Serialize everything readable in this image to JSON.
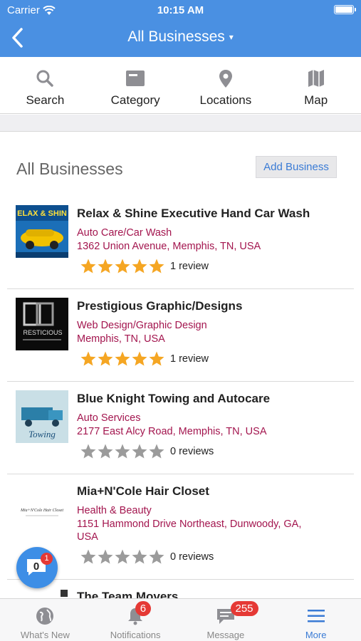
{
  "status_bar": {
    "carrier": "Carrier",
    "time": "10:15 AM"
  },
  "nav": {
    "title": "All Businesses",
    "caret": "▾"
  },
  "toolbar": [
    {
      "label": "Search",
      "icon": "search-icon"
    },
    {
      "label": "Category",
      "icon": "category-icon"
    },
    {
      "label": "Locations",
      "icon": "location-pin-icon"
    },
    {
      "label": "Map",
      "icon": "map-icon"
    }
  ],
  "section": {
    "title": "All Businesses",
    "add_button": "Add Business"
  },
  "businesses": [
    {
      "name": "Relax & Shine Executive Hand Car Wash",
      "category": "Auto Care/Car Wash",
      "address": "1362 Union Avenue, Memphis, TN, USA",
      "rating": 5,
      "reviews": "1 review",
      "thumb_text": "ELAX & SHIN"
    },
    {
      "name": "Prestigious Graphic/Designs",
      "category": "Web Design/Graphic Design",
      "address": "Memphis, TN, USA",
      "rating": 5,
      "reviews": "1 review",
      "thumb_text": "RESTICIOUS"
    },
    {
      "name": "Blue Knight Towing and Autocare",
      "category": "Auto Services",
      "address": "2177 East Alcy Road, Memphis, TN, USA",
      "rating": 0,
      "reviews": "0 reviews",
      "thumb_text": "Towing"
    },
    {
      "name": "Mia+N'Cole Hair Closet",
      "category": "Health & Beauty",
      "address": "1151 Hammond Drive Northeast, Dunwoody, GA, USA",
      "rating": 0,
      "reviews": "0 reviews",
      "thumb_text": "Mia+N'Cole Hair Closet"
    },
    {
      "name": "The Team Movers"
    }
  ],
  "chat": {
    "count": "0",
    "badge": "1"
  },
  "tabbar": [
    {
      "label": "What's New",
      "icon": "globe-icon"
    },
    {
      "label": "Notifications",
      "icon": "bell-icon",
      "badge": "6"
    },
    {
      "label": "Message",
      "icon": "message-icon",
      "badge": "255"
    },
    {
      "label": "More",
      "icon": "menu-icon",
      "active": true
    }
  ],
  "colors": {
    "header": "#4a90e2",
    "accent": "#3a7bd5",
    "category_text": "#a3154e",
    "star_gold": "#f5a623",
    "star_gray": "#9b9b9b",
    "badge": "#e53935"
  }
}
